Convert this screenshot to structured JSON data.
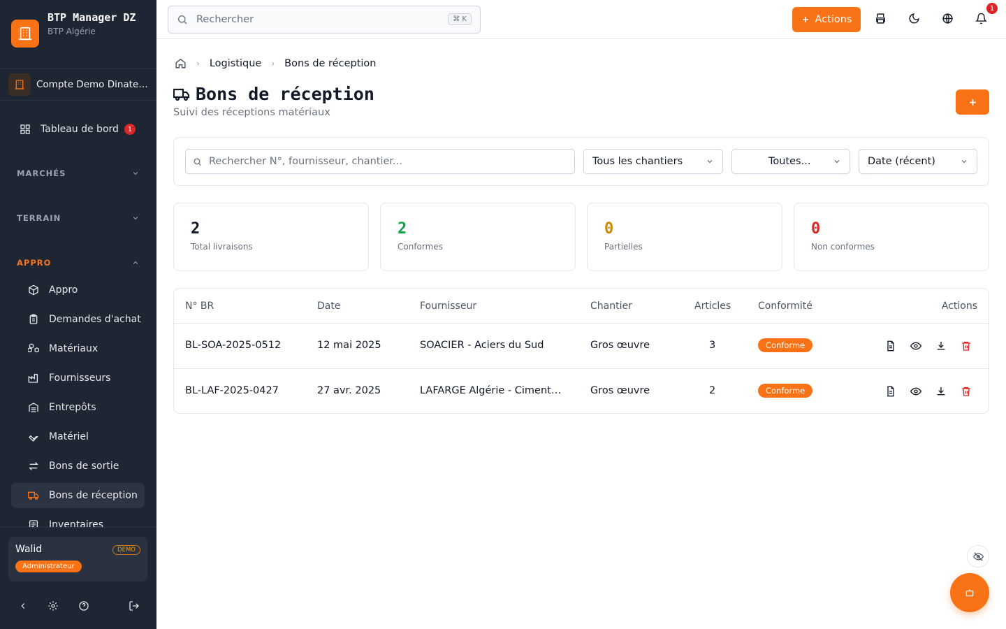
{
  "brand": {
    "title": "BTP Manager DZ",
    "subtitle": "BTP Algérie"
  },
  "account": {
    "name": "Compte Demo Dinateurs"
  },
  "nav": {
    "dashboard": {
      "label": "Tableau de bord",
      "badge": "1"
    },
    "sections": {
      "marches": "MARCHÉS",
      "terrain": "TERRAIN",
      "appro": "APPRO"
    },
    "appro_items": [
      {
        "label": "Appro",
        "icon": "package-icon"
      },
      {
        "label": "Demandes d'achat",
        "icon": "clipboard-icon"
      },
      {
        "label": "Matériaux",
        "icon": "boxes-icon"
      },
      {
        "label": "Fournisseurs",
        "icon": "factory-icon"
      },
      {
        "label": "Entrepôts",
        "icon": "warehouse-icon"
      },
      {
        "label": "Matériel",
        "icon": "wrench-icon"
      },
      {
        "label": "Bons de sortie",
        "icon": "arrows-icon"
      },
      {
        "label": "Bons de réception",
        "icon": "truck-icon",
        "active": true
      },
      {
        "label": "Inventaires",
        "icon": "sheet-icon"
      }
    ]
  },
  "user": {
    "name": "Walid",
    "demo": "DEMO",
    "role": "Administrateur"
  },
  "topbar": {
    "search_placeholder": "Rechercher",
    "shortcut": "⌘ K",
    "actions_label": "Actions",
    "notif_count": "1"
  },
  "breadcrumb": {
    "parent": "Logistique",
    "current": "Bons de réception"
  },
  "page": {
    "title": "Bons de réception",
    "subtitle": "Suivi des réceptions matériaux"
  },
  "filters": {
    "search_placeholder": "Rechercher N°, fournisseur, chantier...",
    "chantier": "Tous les chantiers",
    "status": "Toutes...",
    "sort": "Date (récent)"
  },
  "stats": [
    {
      "value": "2",
      "label": "Total livraisons",
      "color": "#111827"
    },
    {
      "value": "2",
      "label": "Conformes",
      "color": "#16a34a"
    },
    {
      "value": "0",
      "label": "Partielles",
      "color": "#ca8a04"
    },
    {
      "value": "0",
      "label": "Non conformes",
      "color": "#dc2626"
    }
  ],
  "table": {
    "headers": [
      "N° BR",
      "Date",
      "Fournisseur",
      "Chantier",
      "Articles",
      "Conformité",
      "Actions"
    ],
    "rows": [
      {
        "num": "BL-SOA-2025-0512",
        "date": "12 mai 2025",
        "fournisseur": "SOACIER - Aciers du Sud",
        "chantier": "Gros œuvre",
        "articles": "3",
        "conformite": "Conforme"
      },
      {
        "num": "BL-LAF-2025-0427",
        "date": "27 avr. 2025",
        "fournisseur": "LAFARGE Algérie - Cimenterie",
        "chantier": "Gros œuvre",
        "articles": "2",
        "conformite": "Conforme"
      }
    ]
  },
  "colors": {
    "accent": "#f97316",
    "sidebar": "#1e2533",
    "danger": "#dc2626"
  }
}
